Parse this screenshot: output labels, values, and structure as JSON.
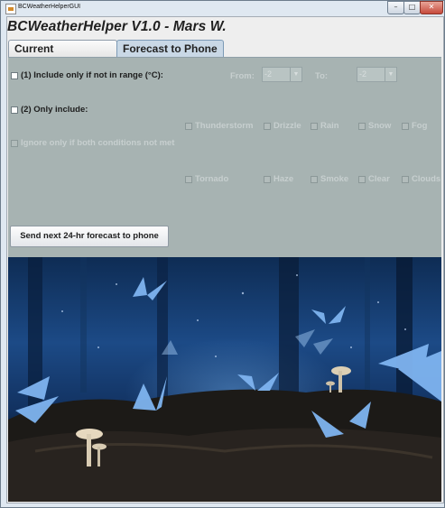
{
  "window": {
    "title": "BCWeatherHelperGUI",
    "min_glyph": "–",
    "max_glyph": "□",
    "close_glyph": "✕"
  },
  "app": {
    "heading": "BCWeatherHelper V1.0 - Mars W."
  },
  "tabs": [
    {
      "label": "Current Conditions",
      "selected": false
    },
    {
      "label": "Forecast to Phone",
      "selected": true
    }
  ],
  "forecast": {
    "option1": {
      "label": "(1) Include only if not in range (°C):",
      "checked": false
    },
    "from": {
      "label": "From:",
      "value": "-2",
      "enabled": false
    },
    "to": {
      "label": "To:",
      "value": "-2",
      "enabled": false
    },
    "option2": {
      "label": "(2) Only include:",
      "checked": false
    },
    "conditions": [
      {
        "label": "Thunderstorm",
        "checked": false,
        "enabled": false
      },
      {
        "label": "Drizzle",
        "checked": false,
        "enabled": false
      },
      {
        "label": "Rain",
        "checked": false,
        "enabled": false
      },
      {
        "label": "Snow",
        "checked": false,
        "enabled": false
      },
      {
        "label": "Fog",
        "checked": false,
        "enabled": false
      },
      {
        "label": "Tornado",
        "checked": false,
        "enabled": false
      },
      {
        "label": "Haze",
        "checked": false,
        "enabled": false
      },
      {
        "label": "Smoke",
        "checked": false,
        "enabled": false
      },
      {
        "label": "Clear",
        "checked": false,
        "enabled": false
      },
      {
        "label": "Clouds",
        "checked": false,
        "enabled": false
      }
    ],
    "ignore": {
      "label": "Ignore only if both conditions not met",
      "checked": false,
      "enabled": false
    },
    "send_button": "Send next 24-hr forecast to phone"
  },
  "colors": {
    "panel_bg": "#a7b3b2",
    "disabled_text": "#c7cfcf",
    "butterfly": "#7fb4f0"
  }
}
